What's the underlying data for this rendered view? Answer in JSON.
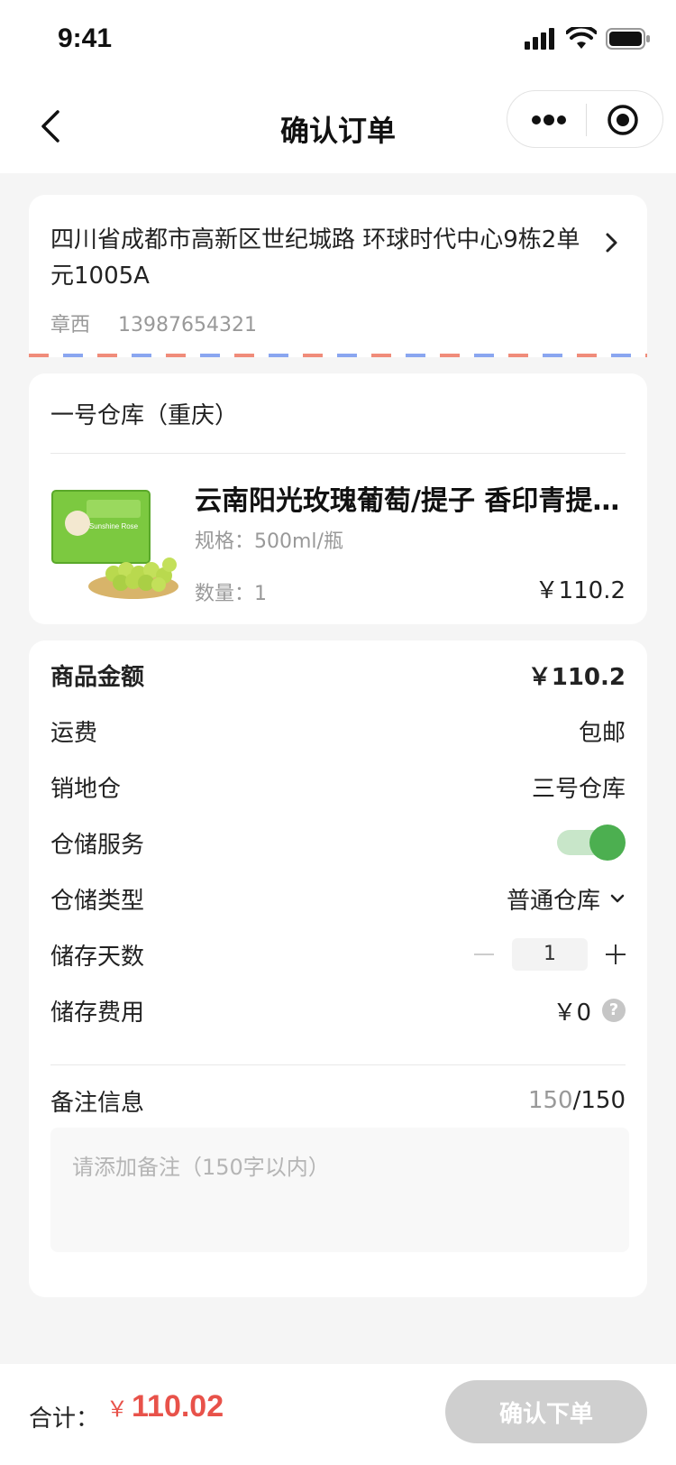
{
  "status_bar": {
    "time": "9:41"
  },
  "nav": {
    "title": "确认订单"
  },
  "address": {
    "text": "四川省成都市高新区世纪城路 环球时代中心9栋2单元1005A",
    "name": "章西",
    "phone": "13987654321"
  },
  "goods": {
    "warehouse": "一号仓库（重庆）",
    "name": "云南阳光玫瑰葡萄/提子 香印青提 新鲜水果",
    "spec": "规格：500ml/瓶",
    "qty": "数量：1",
    "price": "￥110.2",
    "image_label": "Sunshine Rose"
  },
  "summary": {
    "goods_amount_label": "商品金额",
    "goods_amount_value": "￥110.2",
    "shipping_label": "运费",
    "shipping_value": "包邮",
    "sale_warehouse_label": "销地仓",
    "sale_warehouse_value": "三号仓库",
    "storage_service_label": "仓储服务",
    "storage_service_on": true,
    "storage_type_label": "仓储类型",
    "storage_type_value": "普通仓库",
    "storage_days_label": "储存天数",
    "storage_days_value": "1",
    "storage_fee_label": "储存费用",
    "storage_fee_value": "￥0",
    "help_glyph": "?",
    "remark_label": "备注信息",
    "remark_count_current": "150",
    "remark_count_max": "/150",
    "remark_placeholder": "请添加备注（150字以内）"
  },
  "bottom": {
    "total_label": "合计：",
    "currency": "￥",
    "total_value": "110.02",
    "submit_label": "确认下单"
  },
  "colors": {
    "accent_green": "#4caf50",
    "price_red": "#e8524a",
    "disabled_button": "#cfcfcf"
  }
}
